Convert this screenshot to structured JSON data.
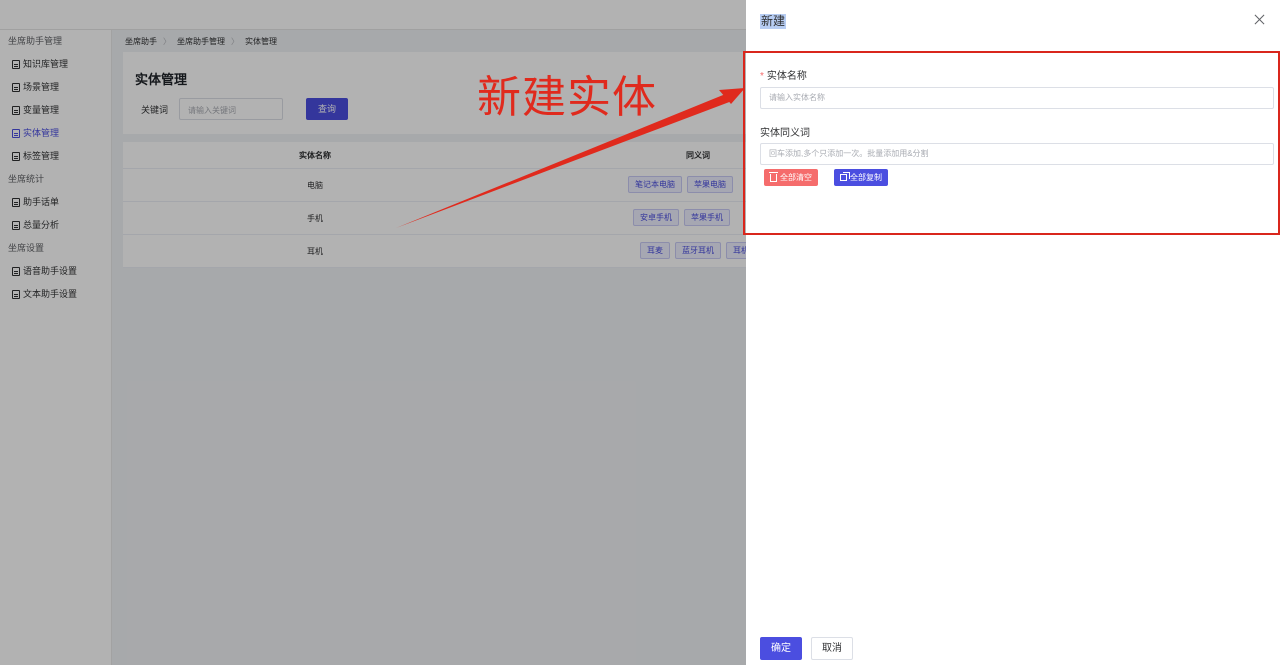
{
  "sidebar": {
    "groups": [
      {
        "title": "坐席助手管理",
        "items": [
          {
            "label": "知识库管理",
            "active": false
          },
          {
            "label": "场景管理",
            "active": false
          },
          {
            "label": "变量管理",
            "active": false
          },
          {
            "label": "实体管理",
            "active": true
          },
          {
            "label": "标签管理",
            "active": false
          }
        ]
      },
      {
        "title": "坐席统计",
        "items": [
          {
            "label": "助手话单",
            "active": false
          },
          {
            "label": "总量分析",
            "active": false
          }
        ]
      },
      {
        "title": "坐席设置",
        "items": [
          {
            "label": "语音助手设置",
            "active": false
          },
          {
            "label": "文本助手设置",
            "active": false
          }
        ]
      }
    ]
  },
  "breadcrumb": [
    "坐席助手",
    "坐席助手管理",
    "实体管理"
  ],
  "page": {
    "title": "实体管理",
    "keyword_label": "关键词",
    "keyword_placeholder": "请输入关键词",
    "query_label": "查询"
  },
  "table": {
    "headers": [
      "实体名称",
      "同义词"
    ],
    "rows": [
      {
        "name": "电脑",
        "synonyms": [
          "笔记本电脑",
          "苹果电脑"
        ]
      },
      {
        "name": "手机",
        "synonyms": [
          "安卓手机",
          "苹果手机"
        ]
      },
      {
        "name": "耳机",
        "synonyms": [
          "耳麦",
          "蓝牙耳机",
          "耳机"
        ]
      }
    ]
  },
  "annotation": {
    "text": "新建实体",
    "color": "#e02a1d"
  },
  "drawer": {
    "title": "新建",
    "fields": {
      "name_label": "实体名称",
      "name_placeholder": "请输入实体名称",
      "synonym_label": "实体同义词",
      "synonym_placeholder": "回车添加,多个只添加一次。批量添加用&分割"
    },
    "clear_all_label": "全部清空",
    "copy_all_label": "全部复制",
    "confirm_label": "确定",
    "cancel_label": "取消"
  },
  "colors": {
    "accent": "#4b4ee0",
    "danger": "#f56c6c",
    "annotation": "#d9261c"
  }
}
